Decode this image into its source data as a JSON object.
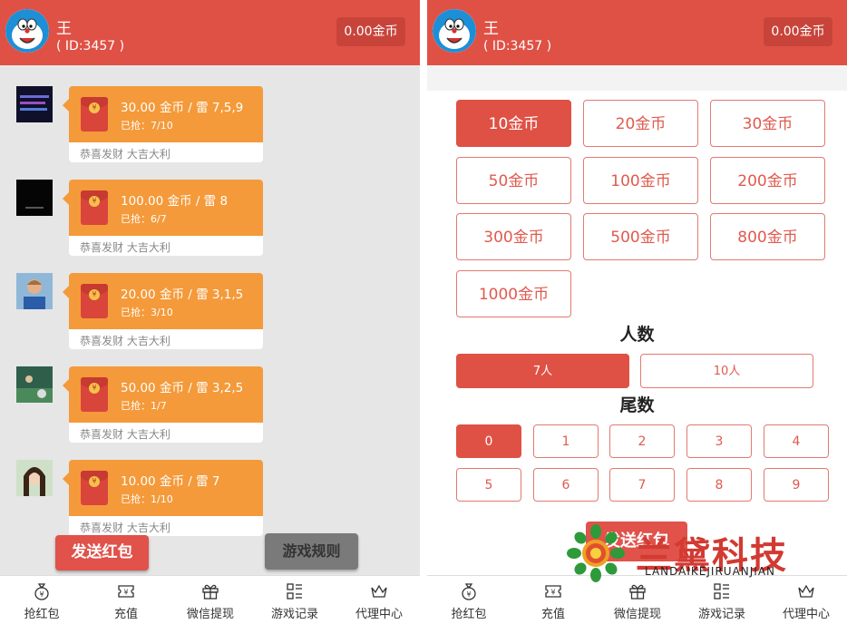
{
  "user": {
    "name": "王",
    "id_text": "( ID:3457 )",
    "coins": "0.00金币"
  },
  "messages": [
    {
      "amount": "30.00 金币 / 雷 7,5,9",
      "grabbed": "已抢：7/10",
      "wish": "恭喜发财 大吉大利",
      "avatar": "dark-avatar"
    },
    {
      "amount": "100.00 金币 / 雷 8",
      "grabbed": "已抢：6/7",
      "wish": "恭喜发财 大吉大利",
      "avatar": "black-avatar"
    },
    {
      "amount": "20.00 金币 / 雷 3,1,5",
      "grabbed": "已抢：3/10",
      "wish": "恭喜发财 大吉大利",
      "avatar": "person-avatar"
    },
    {
      "amount": "50.00 金币 / 雷 3,2,5",
      "grabbed": "已抢：1/7",
      "wish": "恭喜发财 大吉大利",
      "avatar": "sport-avatar"
    },
    {
      "amount": "10.00 金币 / 雷 7",
      "grabbed": "已抢：1/10",
      "wish": "恭喜发财 大吉大利",
      "avatar": "girl-avatar"
    }
  ],
  "left_buttons": {
    "send": "发送红包",
    "rules": "游戏规则"
  },
  "tabs": [
    {
      "label": "抢红包",
      "icon": "money-bag-icon"
    },
    {
      "label": "充值",
      "icon": "ticket-icon"
    },
    {
      "label": "微信提现",
      "icon": "gift-icon"
    },
    {
      "label": "游戏记录",
      "icon": "list-icon"
    },
    {
      "label": "代理中心",
      "icon": "crown-icon"
    }
  ],
  "amounts": [
    "10金币",
    "20金币",
    "30金币",
    "50金币",
    "100金币",
    "200金币",
    "300金币",
    "500金币",
    "800金币",
    "1000金币"
  ],
  "amount_selected": 0,
  "people_title": "人数",
  "people": [
    "7人",
    "10人"
  ],
  "people_selected": 0,
  "tail_title": "尾数",
  "tails": [
    "0",
    "1",
    "2",
    "3",
    "4",
    "5",
    "6",
    "7",
    "8",
    "9"
  ],
  "tail_selected": 0,
  "right_send": "发送红包",
  "watermark": {
    "name": "兰黛科技",
    "sub": "LANDAIKEJIRUANJIAN"
  },
  "colors": {
    "primary": "#df5145",
    "orange": "#f49a3a",
    "background": "#e6e6e6"
  }
}
